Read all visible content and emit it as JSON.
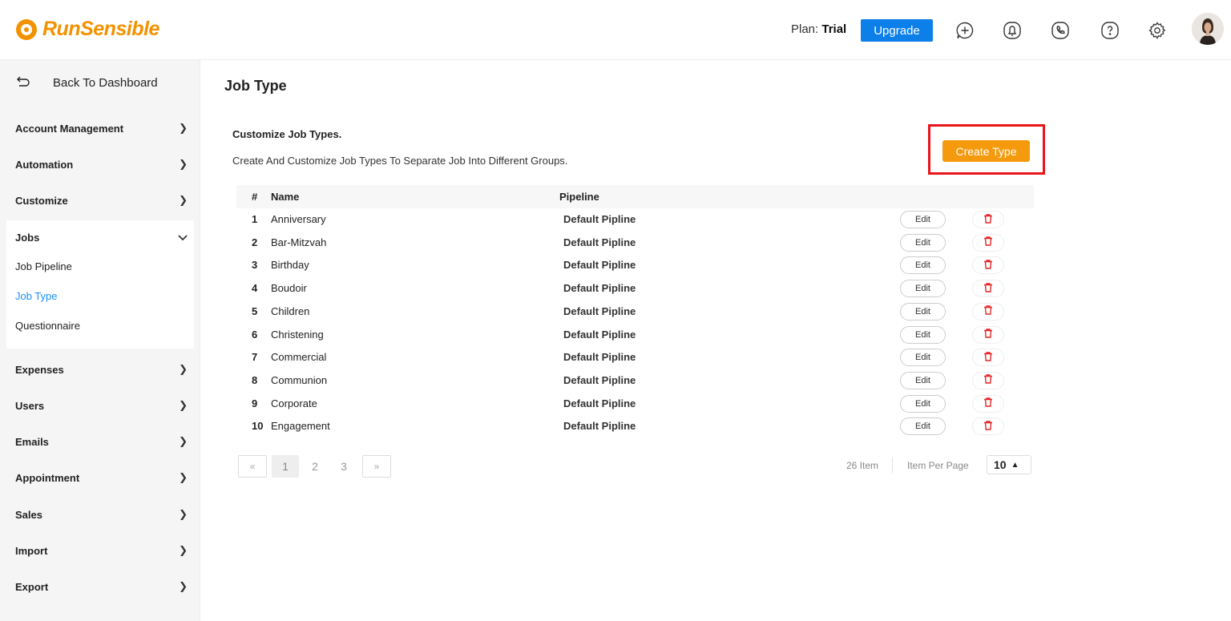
{
  "header": {
    "logo_text": "RunSensible",
    "plan_label": "Plan:",
    "plan_value": "Trial",
    "upgrade_label": "Upgrade",
    "icons": [
      "add-icon",
      "bell-icon",
      "phone-icon",
      "help-icon",
      "gear-icon"
    ],
    "accent_color": "#f39200",
    "upgrade_color": "#0d7fe8"
  },
  "sidebar": {
    "back_label": "Back To Dashboard",
    "items": [
      {
        "label": "Account Management"
      },
      {
        "label": "Automation"
      },
      {
        "label": "Customize"
      },
      {
        "label": "Jobs"
      },
      {
        "label": "Expenses"
      },
      {
        "label": "Users"
      },
      {
        "label": "Emails"
      },
      {
        "label": "Appointment"
      },
      {
        "label": "Sales"
      },
      {
        "label": "Import"
      },
      {
        "label": "Export"
      }
    ],
    "jobs_sub": [
      {
        "label": "Job Pipeline"
      },
      {
        "label": "Job Type"
      },
      {
        "label": "Questionnaire"
      }
    ],
    "active_color": "#1890ff"
  },
  "main": {
    "page_title": "Job Type",
    "subtitle": "Customize Job Types.",
    "description": "Create And Customize Job Types To Separate Job Into Different Groups.",
    "create_button": "Create Type",
    "create_color": "#f59a0c",
    "highlight_color": "#e8141a",
    "columns": {
      "num": "#",
      "name": "Name",
      "pipeline": "Pipeline"
    },
    "edit_label": "Edit",
    "rows": [
      {
        "num": "1",
        "name": "Anniversary",
        "pipeline": "Default Pipline"
      },
      {
        "num": "2",
        "name": "Bar-Mitzvah",
        "pipeline": "Default Pipline"
      },
      {
        "num": "3",
        "name": "Birthday",
        "pipeline": "Default Pipline"
      },
      {
        "num": "4",
        "name": "Boudoir",
        "pipeline": "Default Pipline"
      },
      {
        "num": "5",
        "name": "Children",
        "pipeline": "Default Pipline"
      },
      {
        "num": "6",
        "name": "Christening",
        "pipeline": "Default Pipline"
      },
      {
        "num": "7",
        "name": "Commercial",
        "pipeline": "Default Pipline"
      },
      {
        "num": "8",
        "name": "Communion",
        "pipeline": "Default Pipline"
      },
      {
        "num": "9",
        "name": "Corporate",
        "pipeline": "Default Pipline"
      },
      {
        "num": "10",
        "name": "Engagement",
        "pipeline": "Default Pipline"
      }
    ],
    "pagination": {
      "prev": "«",
      "pages": [
        "1",
        "2",
        "3"
      ],
      "next": "»",
      "items_count": "26 Item",
      "per_page_label": "Item Per Page",
      "per_page_value": "10"
    }
  }
}
